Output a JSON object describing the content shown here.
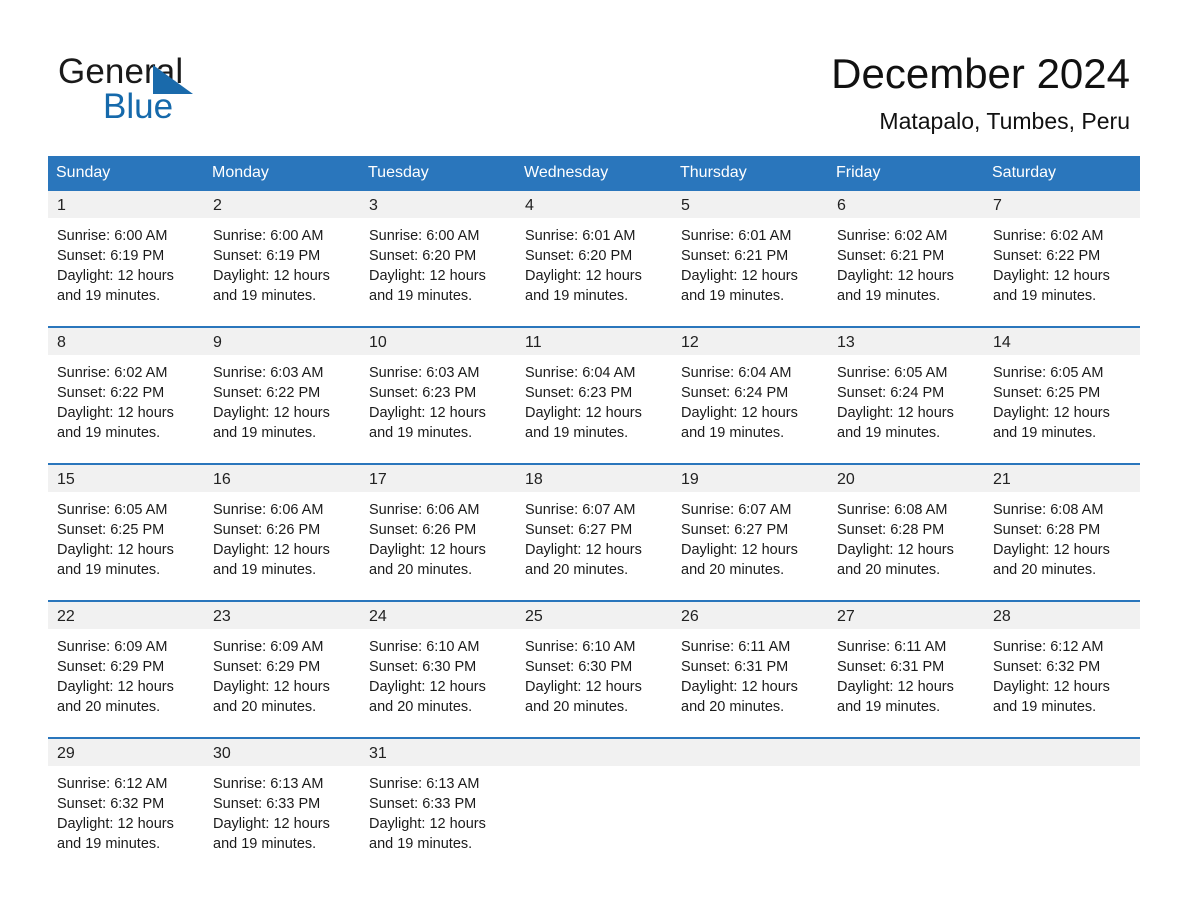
{
  "brand": {
    "word_one": "General",
    "word_two": "Blue",
    "triangle_color": "#1a6aab",
    "blue_color": "#1569ab"
  },
  "header": {
    "month_title": "December 2024",
    "location": "Matapalo, Tumbes, Peru"
  },
  "theme": {
    "header_blue": "#2a76bc",
    "row_gray": "#f1f1f1",
    "text_dark": "#1b1b1b"
  },
  "weekdays": [
    "Sunday",
    "Monday",
    "Tuesday",
    "Wednesday",
    "Thursday",
    "Friday",
    "Saturday"
  ],
  "weeks": [
    [
      {
        "day": "1",
        "sunrise": "Sunrise: 6:00 AM",
        "sunset": "Sunset: 6:19 PM",
        "daylight": "Daylight: 12 hours and 19 minutes."
      },
      {
        "day": "2",
        "sunrise": "Sunrise: 6:00 AM",
        "sunset": "Sunset: 6:19 PM",
        "daylight": "Daylight: 12 hours and 19 minutes."
      },
      {
        "day": "3",
        "sunrise": "Sunrise: 6:00 AM",
        "sunset": "Sunset: 6:20 PM",
        "daylight": "Daylight: 12 hours and 19 minutes."
      },
      {
        "day": "4",
        "sunrise": "Sunrise: 6:01 AM",
        "sunset": "Sunset: 6:20 PM",
        "daylight": "Daylight: 12 hours and 19 minutes."
      },
      {
        "day": "5",
        "sunrise": "Sunrise: 6:01 AM",
        "sunset": "Sunset: 6:21 PM",
        "daylight": "Daylight: 12 hours and 19 minutes."
      },
      {
        "day": "6",
        "sunrise": "Sunrise: 6:02 AM",
        "sunset": "Sunset: 6:21 PM",
        "daylight": "Daylight: 12 hours and 19 minutes."
      },
      {
        "day": "7",
        "sunrise": "Sunrise: 6:02 AM",
        "sunset": "Sunset: 6:22 PM",
        "daylight": "Daylight: 12 hours and 19 minutes."
      }
    ],
    [
      {
        "day": "8",
        "sunrise": "Sunrise: 6:02 AM",
        "sunset": "Sunset: 6:22 PM",
        "daylight": "Daylight: 12 hours and 19 minutes."
      },
      {
        "day": "9",
        "sunrise": "Sunrise: 6:03 AM",
        "sunset": "Sunset: 6:22 PM",
        "daylight": "Daylight: 12 hours and 19 minutes."
      },
      {
        "day": "10",
        "sunrise": "Sunrise: 6:03 AM",
        "sunset": "Sunset: 6:23 PM",
        "daylight": "Daylight: 12 hours and 19 minutes."
      },
      {
        "day": "11",
        "sunrise": "Sunrise: 6:04 AM",
        "sunset": "Sunset: 6:23 PM",
        "daylight": "Daylight: 12 hours and 19 minutes."
      },
      {
        "day": "12",
        "sunrise": "Sunrise: 6:04 AM",
        "sunset": "Sunset: 6:24 PM",
        "daylight": "Daylight: 12 hours and 19 minutes."
      },
      {
        "day": "13",
        "sunrise": "Sunrise: 6:05 AM",
        "sunset": "Sunset: 6:24 PM",
        "daylight": "Daylight: 12 hours and 19 minutes."
      },
      {
        "day": "14",
        "sunrise": "Sunrise: 6:05 AM",
        "sunset": "Sunset: 6:25 PM",
        "daylight": "Daylight: 12 hours and 19 minutes."
      }
    ],
    [
      {
        "day": "15",
        "sunrise": "Sunrise: 6:05 AM",
        "sunset": "Sunset: 6:25 PM",
        "daylight": "Daylight: 12 hours and 19 minutes."
      },
      {
        "day": "16",
        "sunrise": "Sunrise: 6:06 AM",
        "sunset": "Sunset: 6:26 PM",
        "daylight": "Daylight: 12 hours and 19 minutes."
      },
      {
        "day": "17",
        "sunrise": "Sunrise: 6:06 AM",
        "sunset": "Sunset: 6:26 PM",
        "daylight": "Daylight: 12 hours and 20 minutes."
      },
      {
        "day": "18",
        "sunrise": "Sunrise: 6:07 AM",
        "sunset": "Sunset: 6:27 PM",
        "daylight": "Daylight: 12 hours and 20 minutes."
      },
      {
        "day": "19",
        "sunrise": "Sunrise: 6:07 AM",
        "sunset": "Sunset: 6:27 PM",
        "daylight": "Daylight: 12 hours and 20 minutes."
      },
      {
        "day": "20",
        "sunrise": "Sunrise: 6:08 AM",
        "sunset": "Sunset: 6:28 PM",
        "daylight": "Daylight: 12 hours and 20 minutes."
      },
      {
        "day": "21",
        "sunrise": "Sunrise: 6:08 AM",
        "sunset": "Sunset: 6:28 PM",
        "daylight": "Daylight: 12 hours and 20 minutes."
      }
    ],
    [
      {
        "day": "22",
        "sunrise": "Sunrise: 6:09 AM",
        "sunset": "Sunset: 6:29 PM",
        "daylight": "Daylight: 12 hours and 20 minutes."
      },
      {
        "day": "23",
        "sunrise": "Sunrise: 6:09 AM",
        "sunset": "Sunset: 6:29 PM",
        "daylight": "Daylight: 12 hours and 20 minutes."
      },
      {
        "day": "24",
        "sunrise": "Sunrise: 6:10 AM",
        "sunset": "Sunset: 6:30 PM",
        "daylight": "Daylight: 12 hours and 20 minutes."
      },
      {
        "day": "25",
        "sunrise": "Sunrise: 6:10 AM",
        "sunset": "Sunset: 6:30 PM",
        "daylight": "Daylight: 12 hours and 20 minutes."
      },
      {
        "day": "26",
        "sunrise": "Sunrise: 6:11 AM",
        "sunset": "Sunset: 6:31 PM",
        "daylight": "Daylight: 12 hours and 20 minutes."
      },
      {
        "day": "27",
        "sunrise": "Sunrise: 6:11 AM",
        "sunset": "Sunset: 6:31 PM",
        "daylight": "Daylight: 12 hours and 19 minutes."
      },
      {
        "day": "28",
        "sunrise": "Sunrise: 6:12 AM",
        "sunset": "Sunset: 6:32 PM",
        "daylight": "Daylight: 12 hours and 19 minutes."
      }
    ],
    [
      {
        "day": "29",
        "sunrise": "Sunrise: 6:12 AM",
        "sunset": "Sunset: 6:32 PM",
        "daylight": "Daylight: 12 hours and 19 minutes."
      },
      {
        "day": "30",
        "sunrise": "Sunrise: 6:13 AM",
        "sunset": "Sunset: 6:33 PM",
        "daylight": "Daylight: 12 hours and 19 minutes."
      },
      {
        "day": "31",
        "sunrise": "Sunrise: 6:13 AM",
        "sunset": "Sunset: 6:33 PM",
        "daylight": "Daylight: 12 hours and 19 minutes."
      },
      {
        "day": "",
        "sunrise": "",
        "sunset": "",
        "daylight": ""
      },
      {
        "day": "",
        "sunrise": "",
        "sunset": "",
        "daylight": ""
      },
      {
        "day": "",
        "sunrise": "",
        "sunset": "",
        "daylight": ""
      },
      {
        "day": "",
        "sunrise": "",
        "sunset": "",
        "daylight": ""
      }
    ]
  ]
}
